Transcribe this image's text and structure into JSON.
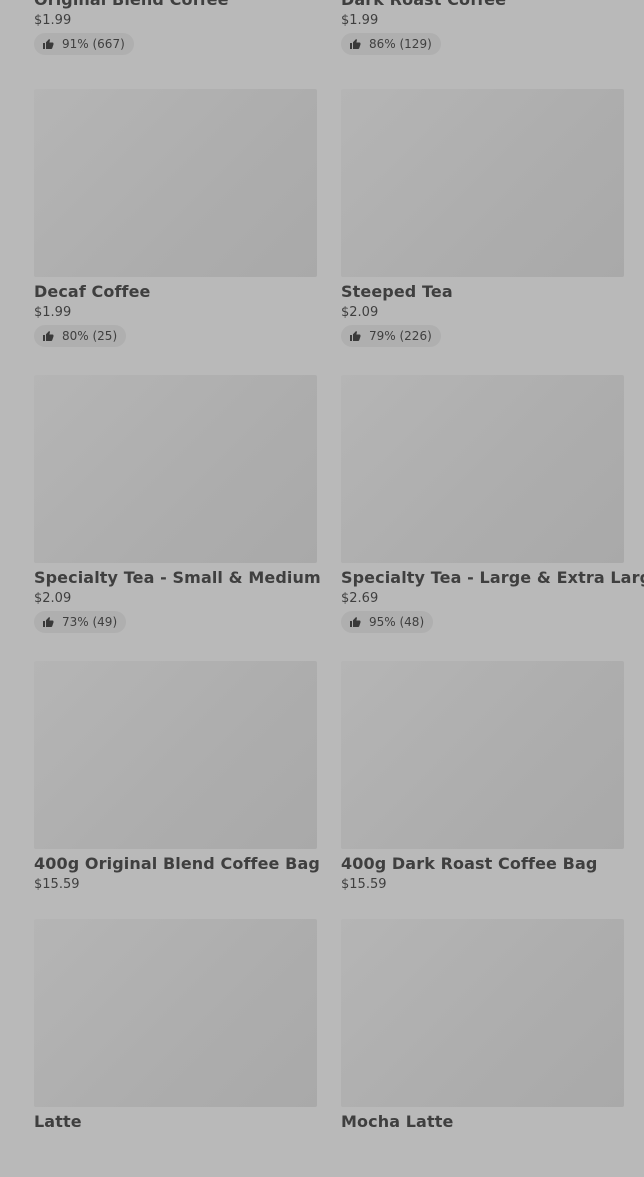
{
  "products": [
    {
      "name": "Original Blend Coffee",
      "price": "$1.99",
      "rating": "91% (667)"
    },
    {
      "name": "Dark Roast Coffee",
      "price": "$1.99",
      "rating": "86% (129)"
    },
    {
      "name": "Decaf Coffee",
      "price": "$1.99",
      "rating": "80% (25)"
    },
    {
      "name": "Steeped Tea",
      "price": "$2.09",
      "rating": "79% (226)"
    },
    {
      "name": "Specialty Tea - Small & Medium",
      "price": "$2.09",
      "rating": "73% (49)"
    },
    {
      "name": "Specialty Tea - Large & Extra Large",
      "price": "$2.69",
      "rating": "95% (48)"
    },
    {
      "name": "400g Original Blend Coffee Bag",
      "price": "$15.59",
      "rating": null
    },
    {
      "name": "400g Dark Roast Coffee Bag",
      "price": "$15.59",
      "rating": null
    },
    {
      "name": "Latte",
      "price": null,
      "rating": null
    },
    {
      "name": "Mocha Latte",
      "price": null,
      "rating": null
    }
  ],
  "icons": {
    "rating": "thumbs-up-icon"
  }
}
